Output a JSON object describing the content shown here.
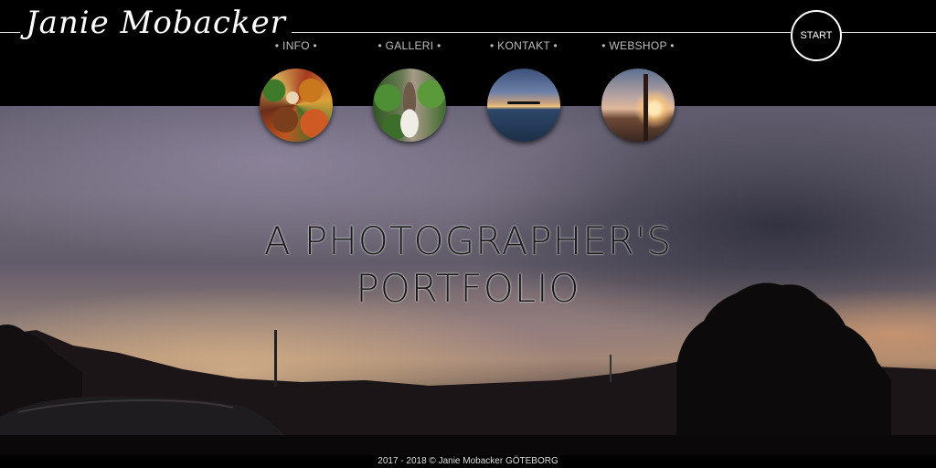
{
  "header": {
    "logo_text": "Janie Mobacker",
    "start_label": "START"
  },
  "nav": {
    "items": [
      {
        "label": "• INFO •"
      },
      {
        "label": "• GALLERI •"
      },
      {
        "label": "• KONTAKT •"
      },
      {
        "label": "• WEBSHOP •"
      }
    ]
  },
  "hero": {
    "title_line1": "A PHOTOGRAPHER'S",
    "title_line2": "PORTFOLIO"
  },
  "footer": {
    "copyright": "2017 - 2018 © Janie Mobacker GÖTEBORG"
  },
  "colors": {
    "header_bg": "#000000",
    "nav_text": "#bdbdbd",
    "title_text": "#1a1a1a"
  }
}
